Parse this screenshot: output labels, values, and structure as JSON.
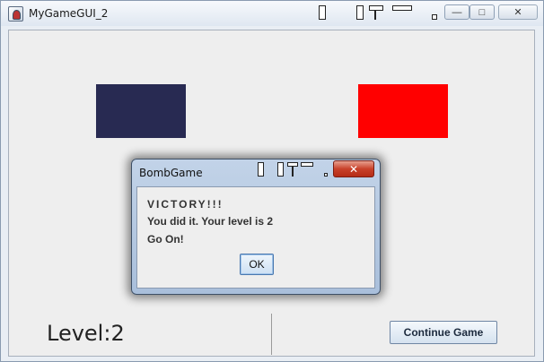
{
  "main_window": {
    "title": "MyGameGUI_2",
    "controls": {
      "minimize": "—",
      "maximize": "□",
      "close": "✕"
    }
  },
  "game": {
    "level_label": "Level:2",
    "continue_button": "Continue Game",
    "colors": {
      "dark_block": "#282a52",
      "red_block": "#ff0000"
    }
  },
  "dialog": {
    "title": "BombGame",
    "close": "✕",
    "messages": [
      "VICTORY!!!",
      "You did it. Your level is 2",
      "Go On!"
    ],
    "ok_button": "OK"
  }
}
